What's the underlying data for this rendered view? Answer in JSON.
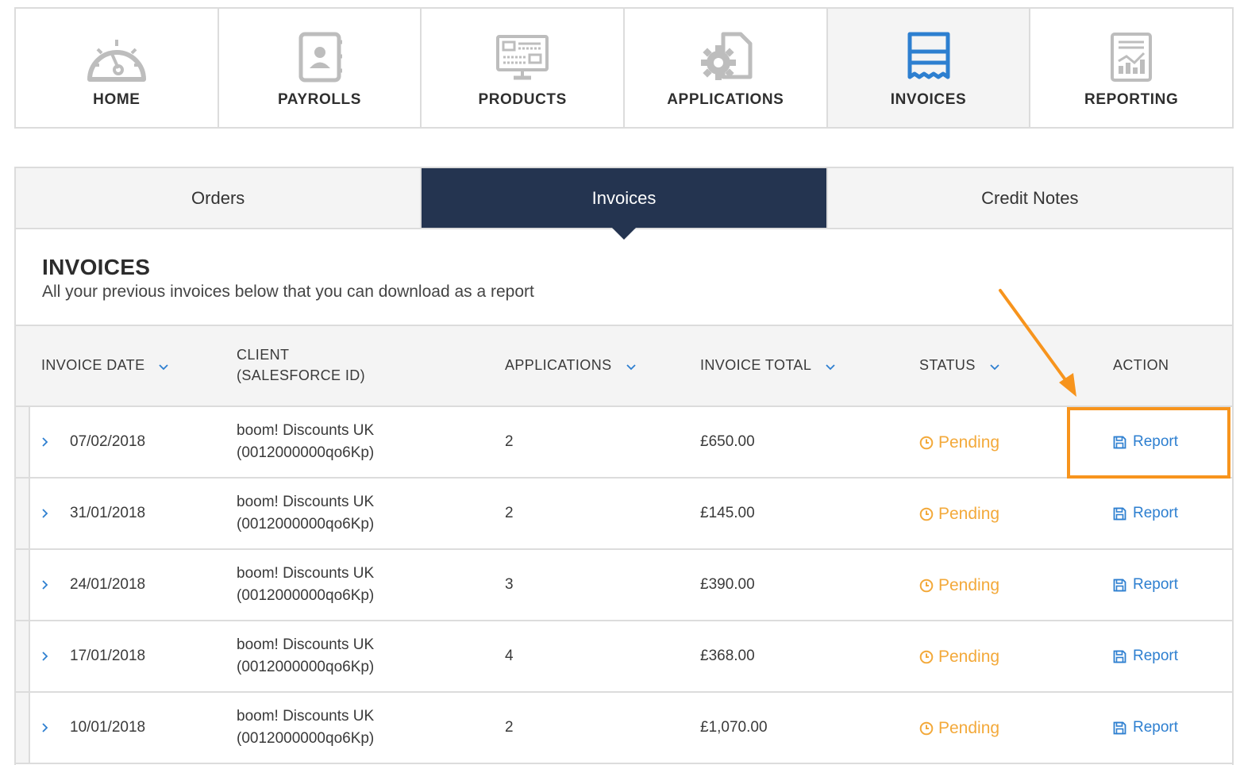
{
  "nav": {
    "items": [
      {
        "label": "HOME",
        "icon": "dashboard-gauge-icon"
      },
      {
        "label": "PAYROLLS",
        "icon": "contact-book-icon"
      },
      {
        "label": "PRODUCTS",
        "icon": "monitor-icon"
      },
      {
        "label": "APPLICATIONS",
        "icon": "gear-document-icon"
      },
      {
        "label": "INVOICES",
        "icon": "invoice-receipt-icon"
      },
      {
        "label": "REPORTING",
        "icon": "report-chart-icon"
      }
    ],
    "active": "INVOICES"
  },
  "subtabs": [
    {
      "label": "Orders"
    },
    {
      "label": "Invoices"
    },
    {
      "label": "Credit Notes"
    }
  ],
  "section": {
    "title": "INVOICES",
    "subtitle": "All your previous invoices below that you can download as a report"
  },
  "table": {
    "headers": {
      "invoice_date": "INVOICE DATE",
      "client_line1": "CLIENT",
      "client_line2": "(SALESFORCE ID)",
      "applications": "APPLICATIONS",
      "invoice_total": "INVOICE TOTAL",
      "status": "STATUS",
      "action": "ACTION"
    },
    "rows": [
      {
        "date": "07/02/2018",
        "client": "boom! Discounts UK",
        "client_id": "(0012000000qo6Kp)",
        "applications": "2",
        "total": "£650.00",
        "status": "Pending",
        "action": "Report"
      },
      {
        "date": "31/01/2018",
        "client": "boom! Discounts UK",
        "client_id": "(0012000000qo6Kp)",
        "applications": "2",
        "total": "£145.00",
        "status": "Pending",
        "action": "Report"
      },
      {
        "date": "24/01/2018",
        "client": "boom! Discounts UK",
        "client_id": "(0012000000qo6Kp)",
        "applications": "3",
        "total": "£390.00",
        "status": "Pending",
        "action": "Report"
      },
      {
        "date": "17/01/2018",
        "client": "boom! Discounts UK",
        "client_id": "(0012000000qo6Kp)",
        "applications": "4",
        "total": "£368.00",
        "status": "Pending",
        "action": "Report"
      },
      {
        "date": "10/01/2018",
        "client": "boom! Discounts UK",
        "client_id": "(0012000000qo6Kp)",
        "applications": "2",
        "total": "£1,070.00",
        "status": "Pending",
        "action": "Report"
      }
    ]
  },
  "colors": {
    "active_tab": "#243450",
    "pending": "#f3a93a",
    "link": "#2d7fd0",
    "accent_icon": "#2d7fd0",
    "annotation": "#f7941d"
  }
}
